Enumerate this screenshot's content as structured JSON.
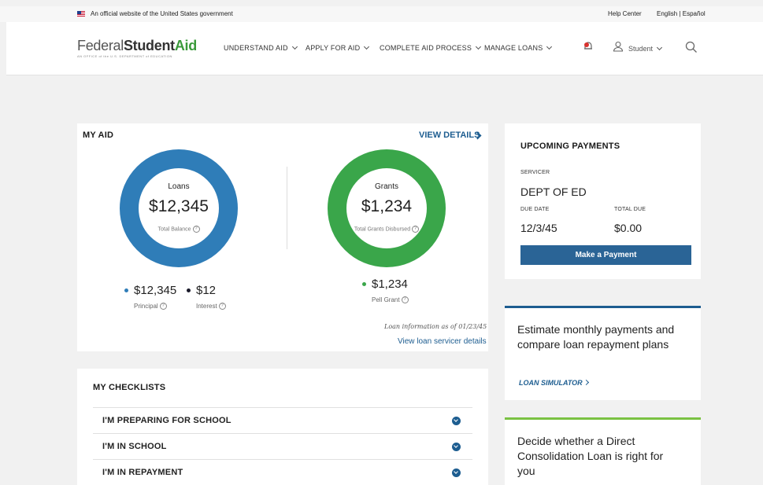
{
  "banner": {
    "official_text": "An official website of the United States government",
    "help_center": "Help Center",
    "language": "English | Español"
  },
  "header": {
    "logo_federal": "Federal",
    "logo_student": "Student",
    "logo_aid": "Aid",
    "logo_sub": "AN OFFICE of the U.S. DEPARTMENT of EDUCATION",
    "nav": [
      {
        "label": "UNDERSTAND AID"
      },
      {
        "label": "APPLY FOR AID"
      },
      {
        "label": "COMPLETE AID PROCESS"
      },
      {
        "label": "MANAGE LOANS"
      }
    ],
    "user_label": "Student"
  },
  "my_aid": {
    "title": "MY AID",
    "view_details": "VIEW DETAILS",
    "loans": {
      "label": "Loans",
      "amount": "$12,345",
      "sub": "Total Balance",
      "principal_value": "$12,345",
      "principal_label": "Principal",
      "interest_value": "$12",
      "interest_label": "Interest"
    },
    "grants": {
      "label": "Grants",
      "amount": "$1,234",
      "sub": "Total Grants Disbursed",
      "pell_value": "$1,234",
      "pell_label": "Pell Grant"
    },
    "as_of": "Loan information as of 01/23/45",
    "servicer_link": "View loan servicer details"
  },
  "payments": {
    "title": "UPCOMING PAYMENTS",
    "servicer_label": "SERVICER",
    "servicer_value": "DEPT OF ED",
    "due_date_label": "DUE DATE",
    "due_date_value": "12/3/45",
    "total_due_label": "TOTAL DUE",
    "total_due_value": "$0.00",
    "button": "Make a Payment"
  },
  "simulator": {
    "text": "Estimate monthly payments and compare loan repayment plans",
    "link": "LOAN SIMULATOR"
  },
  "consolidation": {
    "text": "Decide whether a Direct Consolidation Loan is right for you"
  },
  "checklists": {
    "title": "MY CHECKLISTS",
    "items": [
      {
        "label": "I'M PREPARING FOR SCHOOL"
      },
      {
        "label": "I'M IN SCHOOL"
      },
      {
        "label": "I'M IN REPAYMENT"
      }
    ]
  },
  "colors": {
    "loans_ring": "#2f7db8",
    "grants_ring": "#3aa64a",
    "accent_blue": "#1d5d90",
    "accent_green": "#7ac143"
  },
  "icons": [
    "flag-icon",
    "chevron-down-icon",
    "notification-bell-icon",
    "user-icon",
    "search-icon",
    "chevron-right-icon",
    "help-icon",
    "expand-icon"
  ]
}
